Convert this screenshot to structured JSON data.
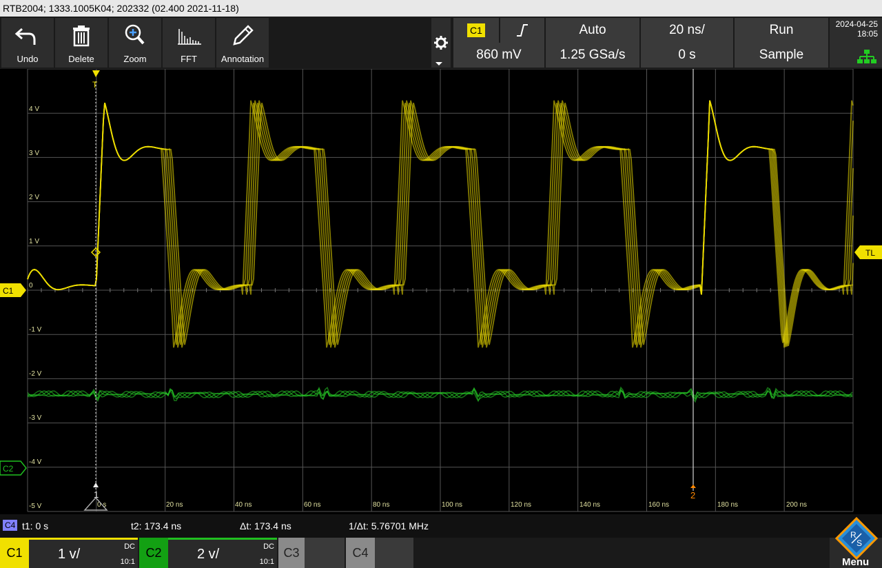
{
  "title": "RTB2004; 1333.1005K04; 202332 (02.400 2021-11-18)",
  "toolbar": {
    "undo": "Undo",
    "delete": "Delete",
    "zoom": "Zoom",
    "fft": "FFT",
    "annotation": "Annotation"
  },
  "trigger": {
    "source": "C1",
    "mode": "Auto",
    "timebase": "20 ns/",
    "run_state": "Run",
    "level": "860 mV",
    "sample_rate": "1.25 GSa/s",
    "position": "0 s",
    "acquisition": "Sample"
  },
  "datetime": {
    "date": "2024-04-25",
    "time": "18:05"
  },
  "grid": {
    "y_labels": [
      "4 V",
      "3 V",
      "2 V",
      "1 V",
      "0",
      "-1 V",
      "-2 V",
      "-3 V",
      "-4 V",
      "-5 V"
    ],
    "x_labels": [
      "0 s",
      "20 ns",
      "40 ns",
      "60 ns",
      "80 ns",
      "100 ns",
      "120 ns",
      "140 ns",
      "160 ns",
      "180 ns",
      "200 ns"
    ]
  },
  "markers": {
    "c1": "C1",
    "c2": "C2",
    "tl": "TL",
    "cursor1": "1",
    "cursor2": "2",
    "trigger_top": "T"
  },
  "cursors": {
    "badge": "C4",
    "t1": "t1: 0 s",
    "t2": "t2: 173.4 ns",
    "dt": "Δt: 173.4 ns",
    "inv_dt": "1/Δt: 5.76701 MHz"
  },
  "channels": [
    {
      "name": "C1",
      "scale": "1 v/",
      "coupling": "DC",
      "probe": "10:1",
      "color": "#f0e000"
    },
    {
      "name": "C2",
      "scale": "2 v/",
      "coupling": "DC",
      "probe": "10:1",
      "color": "#20c020"
    },
    {
      "name": "C3"
    },
    {
      "name": "C4"
    }
  ],
  "menu": "Menu",
  "colors": {
    "ch1": "#f0e000",
    "ch2": "#28d028",
    "cursor2": "#ff8800"
  }
}
